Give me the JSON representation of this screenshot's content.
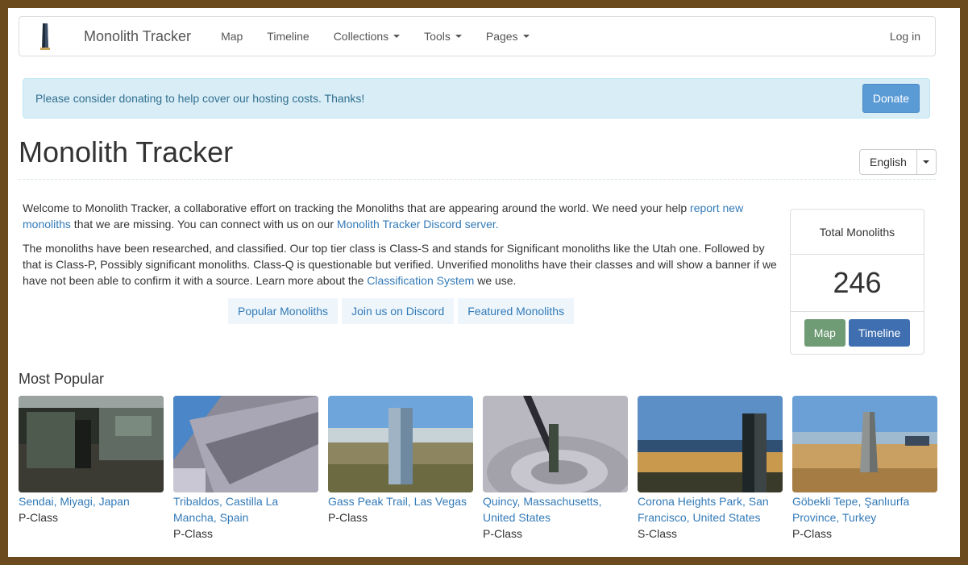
{
  "nav": {
    "brand": "Monolith Tracker",
    "items": [
      {
        "label": "Map",
        "dropdown": false
      },
      {
        "label": "Timeline",
        "dropdown": false
      },
      {
        "label": "Collections",
        "dropdown": true
      },
      {
        "label": "Tools",
        "dropdown": true
      },
      {
        "label": "Pages",
        "dropdown": true
      }
    ],
    "login": "Log in"
  },
  "alert": {
    "text": "Please consider donating to help cover our hosting costs. Thanks!",
    "button": "Donate"
  },
  "page_title": "Monolith Tracker",
  "language": {
    "selected": "English"
  },
  "intro": {
    "p1_a": "Welcome to Monolith Tracker, a collaborative effort on tracking the Monoliths that are appearing around the world. We need your help ",
    "p1_link1": "report new monoliths",
    "p1_b": " that we are missing. You can connect with us on our ",
    "p1_link2": "Monolith Tracker Discord server.",
    "p2_a": "The monoliths have been researched, and classified. Our top tier class is Class-S and stands for Significant monoliths like the Utah one. Followed by that is Class-P, Possibly significant monoliths. Class-Q is questionable but verified. Unverified monoliths have their classes and will show a banner if we have not been able to confirm it with a source. Learn more about the ",
    "p2_link": "Classification System",
    "p2_b": " we use."
  },
  "pills": [
    "Popular Monoliths",
    "Join us on Discord",
    "Featured Monoliths"
  ],
  "stats": {
    "heading": "Total Monoliths",
    "count": "246",
    "map_button": "Map",
    "timeline_button": "Timeline"
  },
  "popular": {
    "heading": "Most Popular",
    "cards": [
      {
        "title": "Sendai, Miyagi, Japan",
        "class": "P-Class"
      },
      {
        "title": "Tribaldos, Castilla La Mancha, Spain",
        "class": "P-Class"
      },
      {
        "title": "Gass Peak Trail, Las Vegas",
        "class": "P-Class"
      },
      {
        "title": "Quincy, Massachusetts, United States",
        "class": "P-Class"
      },
      {
        "title": "Corona Heights Park, San Francisco, United States",
        "class": "S-Class"
      },
      {
        "title": "Göbekli Tepe, Şanlıurfa Province, Turkey",
        "class": "P-Class"
      }
    ]
  },
  "colors": {
    "link": "#337ab7",
    "alert_bg": "#d9edf7",
    "donate": "#5b9bd5",
    "map_button": "#6f9b75",
    "timeline_button": "#3f6fb0",
    "frame": "#6b4a1e"
  }
}
